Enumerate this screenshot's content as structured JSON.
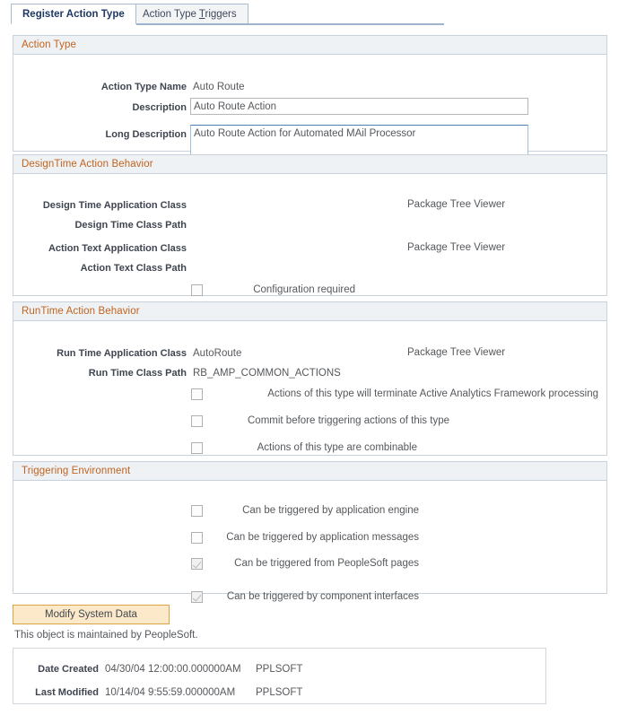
{
  "tabs": [
    {
      "label": "Register Action Type",
      "active": true
    },
    {
      "label_pre": "Action Type ",
      "label_accesskey": "T",
      "label_post": "riggers",
      "active": false
    }
  ],
  "action_type": {
    "header": "Action Type",
    "name_label": "Action Type Name",
    "name_value": "Auto Route",
    "description_label": "Description",
    "description_value": "Auto Route Action",
    "long_description_label": "Long Description",
    "long_description_value": "Auto Route Action for Automated MAil Processor"
  },
  "designtime": {
    "header": "DesignTime Action Behavior",
    "rows": [
      {
        "label": "Design Time Application Class",
        "value": "",
        "link": "Package Tree Viewer"
      },
      {
        "label": "Design Time Class Path",
        "value": "",
        "link": ""
      },
      {
        "label": "Action Text Application Class",
        "value": "",
        "link": "Package Tree Viewer"
      },
      {
        "label": "Action Text Class Path",
        "value": "",
        "link": ""
      }
    ],
    "checkbox": {
      "label": "Configuration required",
      "checked": false
    }
  },
  "runtime": {
    "header": "RunTime Action Behavior",
    "rows": [
      {
        "label": "Run Time Application Class",
        "value": "AutoRoute",
        "link": "Package Tree Viewer"
      },
      {
        "label": "Run Time Class Path",
        "value": "RB_AMP_COMMON_ACTIONS",
        "link": ""
      }
    ],
    "checkboxes": [
      {
        "label": "Actions of this type will terminate Active Analytics Framework processing",
        "checked": false
      },
      {
        "label": "Commit before triggering actions of this type",
        "checked": false
      },
      {
        "label": "Actions of this type are combinable",
        "checked": false
      }
    ]
  },
  "triggering": {
    "header": "Triggering Environment",
    "checkboxes": [
      {
        "label": "Can be triggered by application engine",
        "checked": false
      },
      {
        "label": "Can be triggered by application messages",
        "checked": false
      },
      {
        "label": "Can be triggered from PeopleSoft pages",
        "checked": true
      },
      {
        "label": "Can be triggered by component interfaces",
        "checked": true
      }
    ]
  },
  "footer": {
    "button_label": "Modify System Data",
    "maintained_text": "This object is maintained by PeopleSoft.",
    "rows": [
      {
        "label": "Date Created",
        "datetime": "04/30/04 12:00:00.000000AM",
        "user": "PPLSOFT"
      },
      {
        "label": "Last Modified",
        "datetime": "10/14/04 9:55:59.000000AM",
        "user": "PPLSOFT"
      }
    ]
  },
  "colors": {
    "section_header_text": "#c2631f",
    "section_header_bg": "#eef2f5",
    "active_tab_text": "#1f3864",
    "button_bg": "#fbe9c9",
    "button_border": "#d9a441"
  }
}
